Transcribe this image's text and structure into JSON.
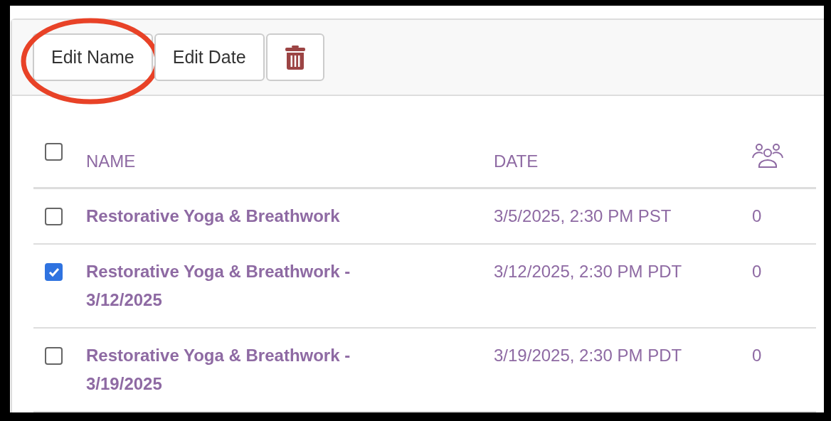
{
  "toolbar": {
    "buttons": [
      {
        "kind": "text",
        "label": "Edit Name",
        "highlighted": true
      },
      {
        "kind": "text",
        "label": "Edit Date",
        "highlighted": false
      },
      {
        "kind": "delete",
        "highlighted": false
      }
    ]
  },
  "table": {
    "select_all": {
      "checked": false
    },
    "columns": [
      {
        "kind": "text",
        "label": "NAME"
      },
      {
        "kind": "text",
        "label": "DATE"
      },
      {
        "kind": "people-icon"
      }
    ],
    "rows": [
      {
        "selected": false,
        "name": "Restorative Yoga & Breathwork",
        "date": "3/5/2025, 2:30 PM PST",
        "count": "0"
      },
      {
        "selected": true,
        "name": "Restorative Yoga & Breathwork - 3/12/2025",
        "date": "3/12/2025, 2:30 PM PDT",
        "count": "0"
      },
      {
        "selected": false,
        "name": "Restorative Yoga & Breathwork - 3/19/2025",
        "date": "3/19/2025, 2:30 PM PDT",
        "count": "0"
      }
    ]
  }
}
